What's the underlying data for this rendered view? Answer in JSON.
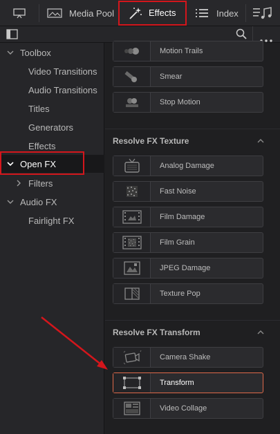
{
  "toolbar": {
    "media_pool": "Media Pool",
    "effects": "Effects",
    "index": "Index"
  },
  "tree": {
    "toolbox": "Toolbox",
    "video_transitions": "Video Transitions",
    "audio_transitions": "Audio Transitions",
    "titles": "Titles",
    "generators": "Generators",
    "effects": "Effects",
    "open_fx": "Open FX",
    "filters": "Filters",
    "audio_fx": "Audio FX",
    "fairlight_fx": "Fairlight FX"
  },
  "effects_list": {
    "top_items": [
      "Motion Trails",
      "Smear",
      "Stop Motion"
    ],
    "texture_section": "Resolve FX Texture",
    "texture_items": [
      "Analog Damage",
      "Fast Noise",
      "Film Damage",
      "Film Grain",
      "JPEG Damage",
      "Texture Pop"
    ],
    "transform_section": "Resolve FX Transform",
    "transform_items": [
      "Camera Shake",
      "Transform",
      "Video Collage"
    ]
  },
  "colors": {
    "highlight_border": "#e06a4a",
    "annotation_red": "#d4161c"
  }
}
